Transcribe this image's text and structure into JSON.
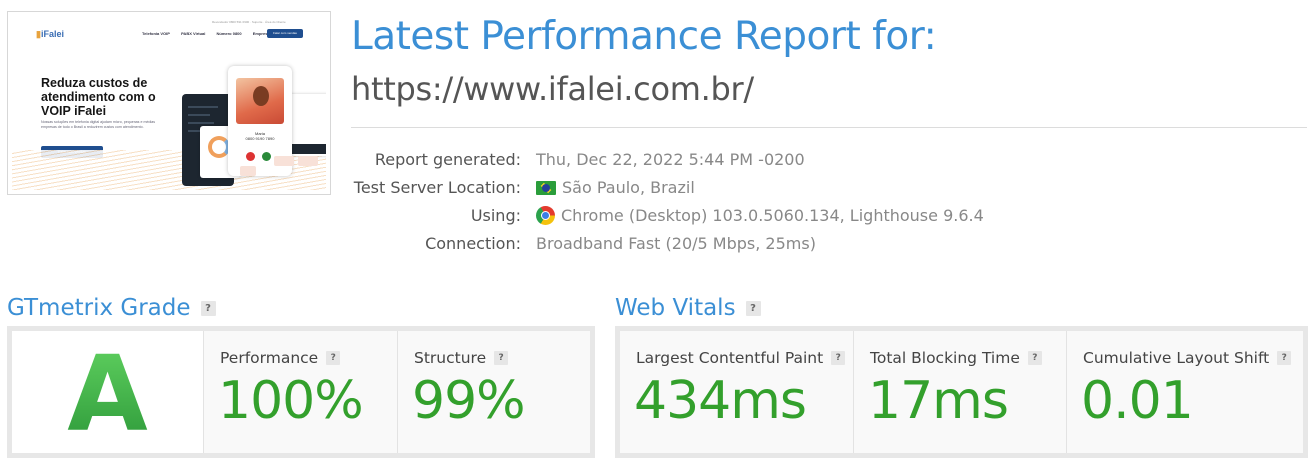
{
  "thumbnail": {
    "logo_brand": "iFalei",
    "top_links": "Revendedor  0800 591 0900  ·  Suporte  ·  Área do Cliente",
    "nav_items": [
      "Telefonia VOIP",
      "PABX Virtual",
      "Número 0800",
      "Empresa"
    ],
    "nav_button": "Falar com vendas",
    "headline": "Reduza custos de atendimento com o VOIP iFalei",
    "subtext": "Nossas soluções em telefonia digital ajudam micro, pequenas e médias empresas de todo o Brasil a reduzirem custos com atendimento.",
    "cta": "Falar com vendas",
    "caller_name": "Maria",
    "caller_number": "0800 9190 7890"
  },
  "header": {
    "title": "Latest Performance Report for:",
    "url": "https://www.ifalei.com.br/"
  },
  "meta": [
    {
      "label": "Report generated:",
      "value": "Thu, Dec 22, 2022 5:44 PM -0200",
      "icon": ""
    },
    {
      "label": "Test Server Location:",
      "value": "São Paulo, Brazil",
      "icon": "brazil-flag-icon"
    },
    {
      "label": "Using:",
      "value": "Chrome (Desktop) 103.0.5060.134, Lighthouse 9.6.4",
      "icon": "chrome-icon"
    },
    {
      "label": "Connection:",
      "value": "Broadband Fast (20/5 Mbps, 25ms)",
      "icon": ""
    }
  ],
  "gtmetrix": {
    "title": "GTmetrix Grade",
    "help": "?",
    "grade": "A",
    "performance": {
      "label": "Performance",
      "value": "100%"
    },
    "structure": {
      "label": "Structure",
      "value": "99%"
    }
  },
  "web_vitals": {
    "title": "Web Vitals",
    "help": "?",
    "lcp": {
      "label": "Largest Contentful Paint",
      "value": "434ms"
    },
    "tbt": {
      "label": "Total Blocking Time",
      "value": "17ms"
    },
    "cls": {
      "label": "Cumulative Layout Shift",
      "value": "0.01"
    }
  },
  "colors": {
    "accent_blue": "#3b8fd5",
    "good_green": "#33a02c"
  }
}
